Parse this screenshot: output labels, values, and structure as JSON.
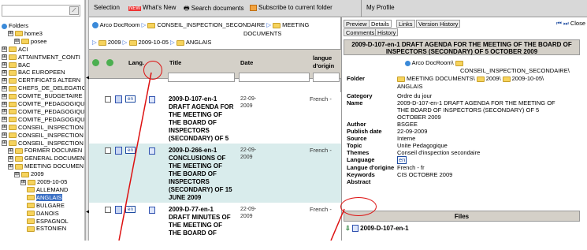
{
  "menu": {
    "selection": "Selection",
    "whats_new": "What's New",
    "search": "Search documents",
    "subscribe": "Subscribe to current folder",
    "profile": "My Profile",
    "new_badge": "NEW"
  },
  "tree": {
    "items": [
      {
        "label": "Folders",
        "indent": 0
      },
      {
        "label": "home3",
        "indent": 1
      },
      {
        "label": "posee",
        "indent": 2
      },
      {
        "label": "ACI",
        "indent": 0
      },
      {
        "label": "ATTAINTMENT_CONTI",
        "indent": 0
      },
      {
        "label": "BAC",
        "indent": 0
      },
      {
        "label": "BAC EUROPEEN",
        "indent": 0
      },
      {
        "label": "CERTIFICATS ALTERN",
        "indent": 0
      },
      {
        "label": "CHEFS_DE_DELEGATIC",
        "indent": 0
      },
      {
        "label": "COMITE_BUDGETAIRE",
        "indent": 0
      },
      {
        "label": "COMITE_PEDAGOGIQU",
        "indent": 0
      },
      {
        "label": "COMITE_PEDAGOGIQU",
        "indent": 0
      },
      {
        "label": "COMITE_PEDAGOGIQU",
        "indent": 0
      },
      {
        "label": "CONSEIL_INSPECTION",
        "indent": 0
      },
      {
        "label": "CONSEIL_INSPECTION",
        "indent": 0
      },
      {
        "label": "CONSEIL_INSPECTION",
        "indent": 0
      },
      {
        "label": "FORMER DOCUMEN",
        "indent": 1
      },
      {
        "label": "GENERAL DOCUMEN",
        "indent": 1
      },
      {
        "label": "MEETING DOCUMEN",
        "indent": 1
      },
      {
        "label": "2009",
        "indent": 2
      },
      {
        "label": "2009-10-05",
        "indent": 3
      },
      {
        "label": "ALLEMAND",
        "indent": 4
      },
      {
        "label": "ANGLAIS",
        "indent": 4
      },
      {
        "label": "BULGARE",
        "indent": 4
      },
      {
        "label": "DANOIS",
        "indent": 4
      },
      {
        "label": "ESPAGNOL",
        "indent": 4
      },
      {
        "label": "ESTONIEN",
        "indent": 4
      }
    ]
  },
  "breadcrumb": {
    "root": "Arco DocRoom",
    "conseil": "CONSEIL_INSPECTION_SECONDAIRE",
    "meeting": "MEETING",
    "documents": "DOCUMENTS",
    "y2009": "2009",
    "date": "2009-10-05",
    "lang": "ANGLAIS"
  },
  "columns": {
    "lang": "Lang.",
    "title": "Title",
    "date": "Date",
    "langue1": "langue",
    "langue2": "d'origin"
  },
  "rows": [
    {
      "lang": "en",
      "title": "2009-D-107-en-1 DRAFT AGENDA FOR THE MEETING OF THE BOARD OF INSPECTORS (SECONDARY) OF 5 OCTOBER 200...",
      "date1": "22-09-",
      "date2": "2009",
      "origin": "French -"
    },
    {
      "lang": "en",
      "title": "2009-D-266-en-1 CONCLUSIONS OF THE MEETING OF THE BOARD OF INSPECTORS (SECONDARY) OF 15 JUNE 2009",
      "date1": "22-09-",
      "date2": "2009",
      "origin": "French -"
    },
    {
      "lang": "en",
      "title": "2009-D-77-en-1 DRAFT MINUTES OF THE MEETING OF THE BOARD OF",
      "date1": "22-09-",
      "date2": "2009",
      "origin": "French -"
    }
  ],
  "tabs": [
    "Preview",
    "Details",
    "Links",
    "Version History",
    "Comments",
    "History"
  ],
  "close_label": "Close",
  "details": {
    "heading": "2009-D-107-en-1 DRAFT AGENDA FOR THE MEETING OF THE BOARD OF INSPECTORS (SECONDARY) OF 5 OCTOBER 2009",
    "folder_label": "Folder",
    "folder_l1": "Arco DocRoom\\",
    "folder_l2": "CONSEIL_INSPECTION_SECONDAIRE\\",
    "folder_l3": "MEETING DOCUMENTS\\",
    "folder_l3b": "2009\\",
    "folder_l3c": "2009-10-05\\",
    "folder_l4": "ANGLAIS",
    "fields": [
      {
        "label": "Category",
        "value": "Ordre du jour"
      },
      {
        "label": "Name",
        "value": "2009-D-107-en-1 DRAFT AGENDA FOR THE MEETING OF"
      },
      {
        "label": "",
        "value": "THE BOARD OF INSPECTORS (SECONDARY) OF 5"
      },
      {
        "label": "",
        "value": "OCTOBER 2009"
      },
      {
        "label": "Author",
        "value": "BSGEE"
      },
      {
        "label": "Publish date",
        "value": "22-09-2009"
      },
      {
        "label": "Source",
        "value": "Interne"
      },
      {
        "label": "Topic",
        "value": "Unite Pedagogique"
      },
      {
        "label": "Themes",
        "value": "Conseil d'inspection secondaire"
      },
      {
        "label": "Language",
        "value": "en"
      },
      {
        "label": "Langue d'origine",
        "value": "French - fr"
      },
      {
        "label": "Keywords",
        "value": "CIS OCTOBRE 2009"
      },
      {
        "label": "Abstract",
        "value": ""
      }
    ]
  },
  "files": {
    "heading": "Files",
    "file": "2009-D-107-en-1"
  }
}
